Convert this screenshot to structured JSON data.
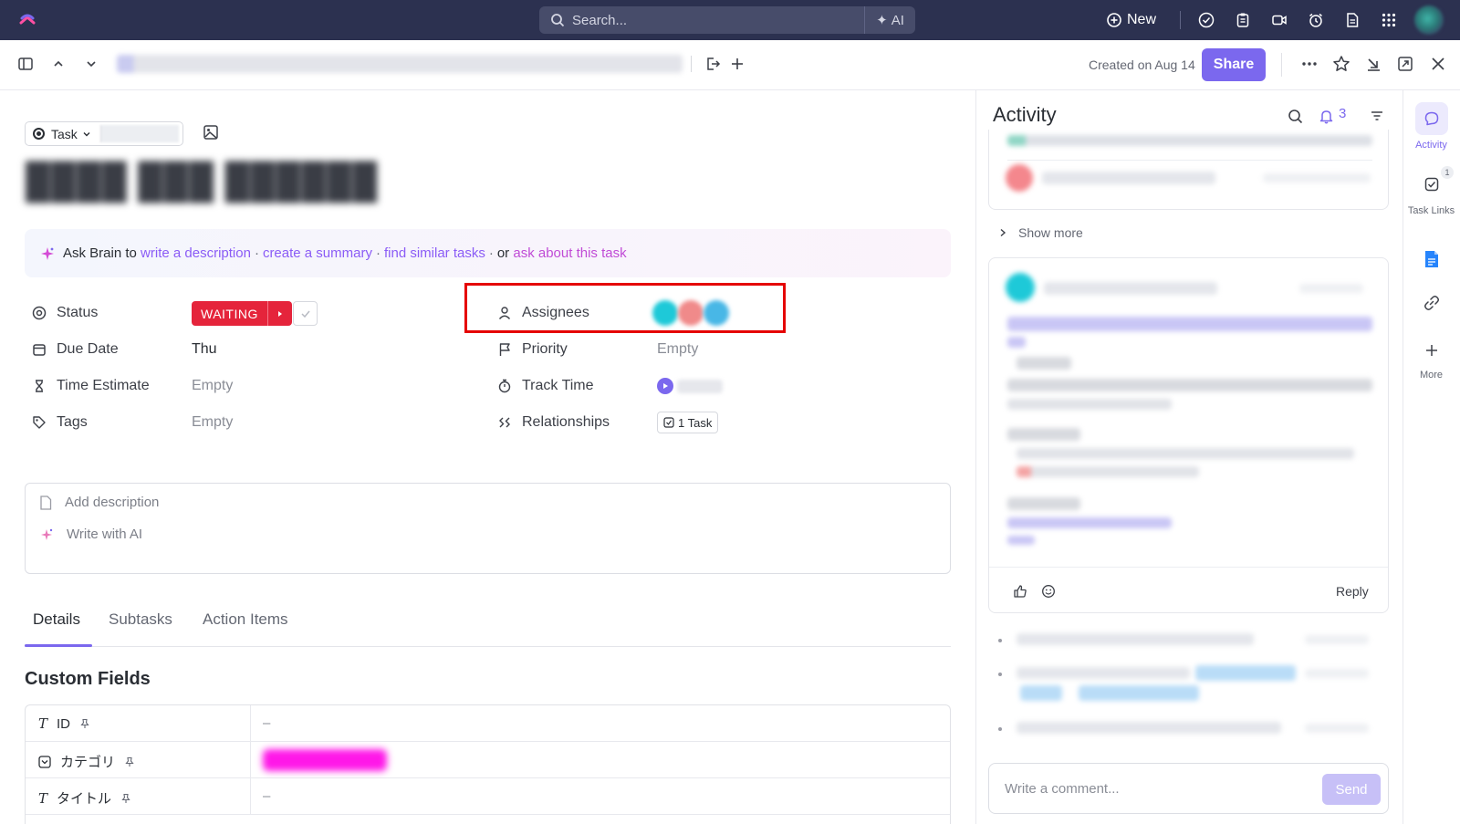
{
  "topbar": {
    "search_placeholder": "Search...",
    "ai_label": "AI",
    "new_label": "New",
    "icons": [
      "check-circle-icon",
      "clipboard-icon",
      "video-icon",
      "alarm-icon",
      "document-icon",
      "apps-grid-icon"
    ]
  },
  "subbar": {
    "created_label": "Created on Aug 14",
    "share_label": "Share"
  },
  "task": {
    "type_label": "Task",
    "fields_left": [
      {
        "label": "Status",
        "icon": "status-icon",
        "value": "WAITING"
      },
      {
        "label": "Due Date",
        "icon": "calendar-icon",
        "value": "Thu"
      },
      {
        "label": "Time Estimate",
        "icon": "hourglass-icon",
        "value": "Empty"
      },
      {
        "label": "Tags",
        "icon": "tag-icon",
        "value": "Empty"
      }
    ],
    "fields_right": [
      {
        "label": "Assignees",
        "icon": "user-icon"
      },
      {
        "label": "Priority",
        "icon": "flag-icon",
        "value": "Empty"
      },
      {
        "label": "Track Time",
        "icon": "stopwatch-icon"
      },
      {
        "label": "Relationships",
        "icon": "relationship-icon",
        "value": "1 Task"
      }
    ]
  },
  "brain": {
    "prefix": "Ask Brain to",
    "link1": "write a description",
    "link2": "create a summary",
    "link3": "find similar tasks",
    "or": "or",
    "link4": "ask about this task",
    "dot": "·"
  },
  "description": {
    "add_label": "Add description",
    "ai_label": "Write with AI"
  },
  "tabs": [
    {
      "label": "Details",
      "active": true
    },
    {
      "label": "Subtasks",
      "active": false
    },
    {
      "label": "Action Items",
      "active": false
    }
  ],
  "custom_fields": {
    "title": "Custom Fields",
    "rows": [
      {
        "name": "ID",
        "icon": "text-type-icon",
        "value": "–"
      },
      {
        "name": "カテゴリ",
        "icon": "dropdown-type-icon",
        "value": ""
      },
      {
        "name": "タイトル",
        "icon": "text-type-icon",
        "value": "–"
      }
    ]
  },
  "activity": {
    "title": "Activity",
    "notification_count": "3",
    "show_more": "Show more",
    "reply_label": "Reply",
    "comment_placeholder": "Write a comment...",
    "send_label": "Send"
  },
  "rail": [
    {
      "label": "Activity",
      "icon": "chat-bubble-icon",
      "active": true
    },
    {
      "label": "Task Links",
      "icon": "task-links-icon",
      "badge": "1"
    },
    {
      "label": "",
      "icon": "google-docs-icon"
    },
    {
      "label": "",
      "icon": "link-icon"
    },
    {
      "label": "More",
      "icon": "plus-icon"
    }
  ],
  "colors": {
    "accent": "#7b68ee",
    "topbar": "#2c3150",
    "status_waiting": "#e5243b",
    "highlight_box": "#e50000"
  }
}
